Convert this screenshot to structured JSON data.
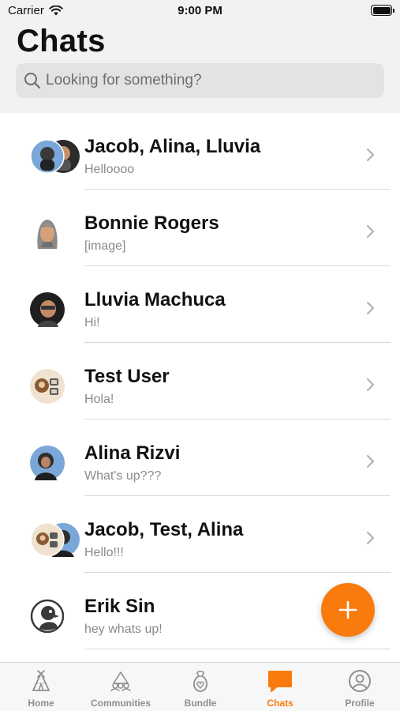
{
  "status_bar": {
    "carrier": "Carrier",
    "time": "9:00 PM"
  },
  "header": {
    "title": "Chats"
  },
  "search": {
    "placeholder": "Looking for something?"
  },
  "chats": [
    {
      "name": "Jacob, Alina, Lluvia",
      "preview": "Helloooo",
      "avatar": "group-avatar"
    },
    {
      "name": "Bonnie Rogers",
      "preview": "[image]",
      "avatar": "person-avatar"
    },
    {
      "name": "Lluvia Machuca",
      "preview": "Hi!",
      "avatar": "person-avatar"
    },
    {
      "name": "Test User",
      "preview": "Hola!",
      "avatar": "person-avatar"
    },
    {
      "name": "Alina Rizvi",
      "preview": "What's up???",
      "avatar": "person-avatar"
    },
    {
      "name": "Jacob, Test, Alina",
      "preview": "Hello!!!",
      "avatar": "group-avatar"
    },
    {
      "name": "Erik Sin",
      "preview": "hey whats up!",
      "avatar": "person-avatar"
    }
  ],
  "tabs": [
    {
      "label": "Home",
      "icon": "tipi-icon",
      "active": false
    },
    {
      "label": "Communities",
      "icon": "communities-icon",
      "active": false
    },
    {
      "label": "Bundle",
      "icon": "bundle-icon",
      "active": false
    },
    {
      "label": "Chats",
      "icon": "chat-bubble-icon",
      "active": true
    },
    {
      "label": "Profile",
      "icon": "profile-icon",
      "active": false
    }
  ],
  "colors": {
    "accent": "#f97b0e",
    "header_bg": "#f2f2f2",
    "separator": "#d8d8d8",
    "secondary_text": "#8a8a8a"
  }
}
